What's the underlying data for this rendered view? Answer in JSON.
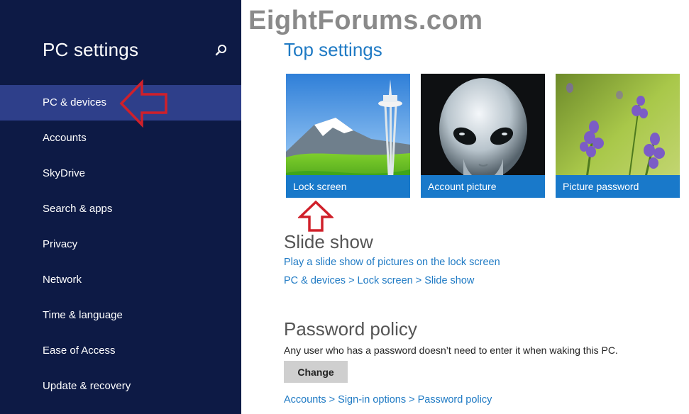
{
  "watermark": "EightForums.com",
  "sidebar": {
    "title": "PC settings",
    "search_icon": "search-icon",
    "items": [
      {
        "label": "PC & devices",
        "active": true
      },
      {
        "label": "Accounts"
      },
      {
        "label": "SkyDrive"
      },
      {
        "label": "Search & apps"
      },
      {
        "label": "Privacy"
      },
      {
        "label": "Network"
      },
      {
        "label": "Time & language"
      },
      {
        "label": "Ease of Access"
      },
      {
        "label": "Update & recovery"
      }
    ]
  },
  "main": {
    "top_settings_title": "Top settings",
    "tiles": [
      {
        "label": "Lock screen"
      },
      {
        "label": "Account picture"
      },
      {
        "label": "Picture password"
      }
    ],
    "slide_show": {
      "title": "Slide show",
      "link": "Play a slide show of pictures on the lock screen",
      "breadcrumb": "PC & devices > Lock screen > Slide show"
    },
    "password_policy": {
      "title": "Password policy",
      "description": "Any user who has a password doesn’t need to enter it when waking this PC.",
      "button": "Change",
      "breadcrumb": "Accounts > Sign-in options > Password policy"
    }
  },
  "colors": {
    "sidebar_bg": "#0d1a45",
    "sidebar_active": "#2e3f8a",
    "accent": "#1979ca",
    "annotation_arrow": "#d0202a"
  }
}
